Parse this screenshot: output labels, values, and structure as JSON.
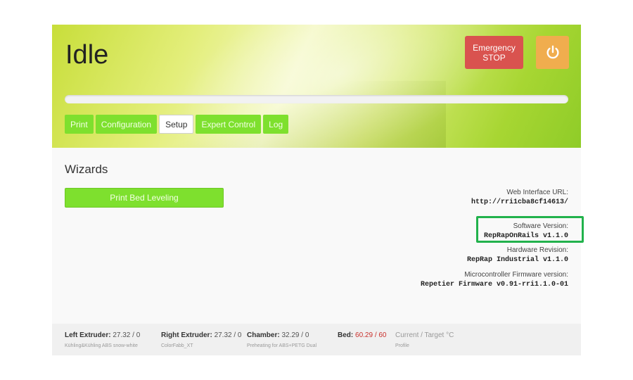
{
  "header": {
    "status": "Idle",
    "estop_label": "Emergency STOP",
    "progress_fraction": 0,
    "tabs": [
      {
        "label": "Print",
        "active": false
      },
      {
        "label": "Configuration",
        "active": false
      },
      {
        "label": "Setup",
        "active": true
      },
      {
        "label": "Expert Control",
        "active": false
      },
      {
        "label": "Log",
        "active": false
      }
    ],
    "power_icon": "power-icon"
  },
  "main": {
    "section_title": "Wizards",
    "wizard_button": "Print Bed Leveling",
    "info": {
      "web_url_label": "Web Interface URL:",
      "web_url_value": "http://rri1cba8cf14613/",
      "software_label": "Software Version:",
      "software_value": "RepRapOnRails v1.1.0",
      "hardware_label": "Hardware Revision:",
      "hardware_value": "RepRap Industrial v1.1.0",
      "firmware_label": "Microcontroller Firmware version:",
      "firmware_value": "Repetier Firmware v0.91-rri1.1.0-01"
    }
  },
  "footer": {
    "left_extruder": {
      "label": "Left Extruder:",
      "value": "27.32 / 0",
      "sub": "Kühling&Kühling ABS snow-white"
    },
    "right_extruder": {
      "label": "Right Extruder:",
      "value": "27.32 / 0",
      "sub": "ColorFabb_XT"
    },
    "chamber": {
      "label": "Chamber:",
      "value": "32.29 / 0",
      "sub": "Preheating for ABS+PETG Dual"
    },
    "bed": {
      "label": "Bed:",
      "value": "60.29 / 60"
    },
    "legend": {
      "label": "Current / Target °C",
      "sub": "Profile"
    }
  },
  "colors": {
    "accent_green": "#7ee02e",
    "estop_red": "#d9534f",
    "power_orange": "#f0ad4e",
    "highlight_green": "#22b24c"
  }
}
